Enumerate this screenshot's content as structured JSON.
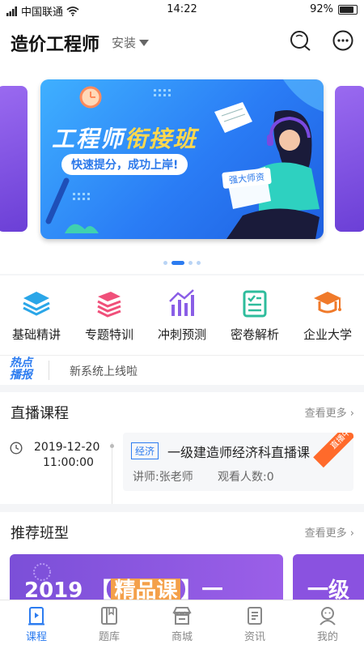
{
  "status_bar": {
    "carrier": "中国联通",
    "time": "14:22",
    "battery": "92%",
    "battery_level": 0.92
  },
  "header": {
    "title": "造价工程师",
    "install_label": "安装",
    "icons": [
      "search-icon",
      "message-icon"
    ]
  },
  "banner": {
    "title_part1": "工程师",
    "title_part2": "衔接班",
    "subtitle": "快速提分，成功上岸!",
    "badge": "强大师资",
    "page_count": 4,
    "active_index": 1
  },
  "categories": [
    {
      "label": "基础精讲",
      "icon": "layers-icon",
      "color": "#2aa6e8"
    },
    {
      "label": "专题特训",
      "icon": "book-stack-icon",
      "color": "#f0507a"
    },
    {
      "label": "冲刺预测",
      "icon": "bar-chart-icon",
      "color": "#8a5ee6"
    },
    {
      "label": "密卷解析",
      "icon": "checklist-icon",
      "color": "#2ebc9c"
    },
    {
      "label": "企业大学",
      "icon": "graduation-cap-icon",
      "color": "#f07a2a"
    }
  ],
  "hot_news": {
    "logo_line1": "热点",
    "logo_line2": "播报",
    "text": "新系统上线啦"
  },
  "live": {
    "title": "直播课程",
    "more_label": "查看更多",
    "date": "2019-12-20",
    "time": "11:00:00",
    "tag": "经济",
    "name": "一级建造师经济科直播课",
    "teacher": "讲师:张老师",
    "views": "观看人数:0",
    "status": "直播中"
  },
  "recommend": {
    "title": "推荐班型",
    "more_label": "查看更多",
    "card1_year": "2019",
    "card1_highlight": "精品课",
    "card1_rest": "一",
    "card2_text": "一级"
  },
  "tabbar": [
    {
      "label": "课程",
      "icon": "course-icon",
      "active": true
    },
    {
      "label": "题库",
      "icon": "question-bank-icon",
      "active": false
    },
    {
      "label": "商城",
      "icon": "shop-icon",
      "active": false
    },
    {
      "label": "资讯",
      "icon": "news-icon",
      "active": false
    },
    {
      "label": "我的",
      "icon": "profile-icon",
      "active": false
    }
  ],
  "colors": {
    "accent": "#2c7cf0",
    "live_ribbon": "#ff6a2b"
  }
}
